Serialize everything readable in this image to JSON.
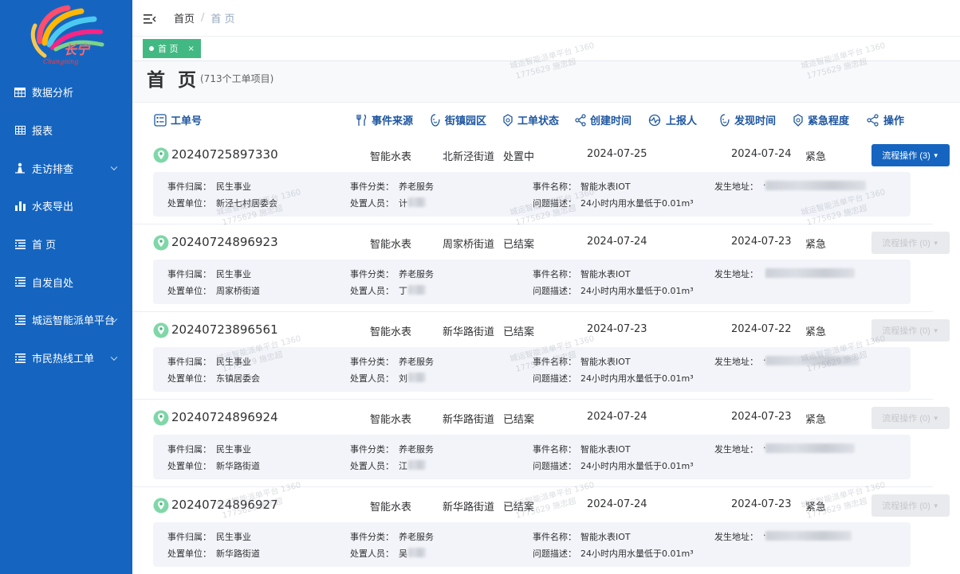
{
  "sidebar": {
    "items": [
      {
        "label": "数据分析",
        "icon": "table-icon",
        "expandable": false
      },
      {
        "label": "报表",
        "icon": "grid-icon",
        "expandable": false
      },
      {
        "label": "走访排查",
        "icon": "person-icon",
        "expandable": true
      },
      {
        "label": "水表导出",
        "icon": "bar-chart-icon",
        "expandable": false
      },
      {
        "label": "首 页",
        "icon": "list-icon",
        "expandable": false
      },
      {
        "label": "自发自处",
        "icon": "list-icon",
        "expandable": false
      },
      {
        "label": "城运智能派单平台",
        "icon": "list-icon",
        "expandable": true
      },
      {
        "label": "市民热线工单",
        "icon": "list-icon",
        "expandable": true
      }
    ]
  },
  "header": {
    "breadcrumb_root": "首页",
    "breadcrumb_sep": "/",
    "breadcrumb_current": "首 页"
  },
  "tags": {
    "active_label": "首 页",
    "close": "×"
  },
  "page": {
    "title": "首 页",
    "count": "(713个工单项目)"
  },
  "columns": {
    "work_order": "工单号",
    "source": "事件来源",
    "street": "街镇园区",
    "status": "工单状态",
    "created": "创建时间",
    "reporter": "上报人",
    "found": "发现时间",
    "urgency": "紧急程度",
    "action": "操作"
  },
  "detail_labels": {
    "belong": "事件归属：",
    "unit": "处置单位：",
    "category": "事件分类：",
    "person": "处置人员：",
    "name": "事件名称：",
    "desc": "问题描述：",
    "address": "发生地址："
  },
  "rows": [
    {
      "id": "20240725897330",
      "source": "智能水表",
      "street": "北新泾街道",
      "status": "处置中",
      "created": "2024-07-25",
      "found": "2024-07-24",
      "urgency": "紧急",
      "action": "流程操作 (3)",
      "action_enabled": true,
      "belong": "民生事业",
      "unit": "新泾七村居委会",
      "category": "养老服务",
      "person": "计",
      "name": "智能水表IOT",
      "desc": "24小时内用水量低于0.01m³",
      "address": "·"
    },
    {
      "id": "20240724896923",
      "source": "智能水表",
      "street": "周家桥街道",
      "status": "已结案",
      "created": "2024-07-24",
      "found": "2024-07-23",
      "urgency": "紧急",
      "action": "流程操作 (0)",
      "action_enabled": false,
      "belong": "民生事业",
      "unit": "周家桥街道",
      "category": "养老服务",
      "person": "丁",
      "name": "智能水表IOT",
      "desc": "24小时内用水量低于0.01m³",
      "address": ""
    },
    {
      "id": "20240723896561",
      "source": "智能水表",
      "street": "新华路街道",
      "status": "已结案",
      "created": "2024-07-23",
      "found": "2024-07-22",
      "urgency": "紧急",
      "action": "流程操作 (0)",
      "action_enabled": false,
      "belong": "民生事业",
      "unit": "东镇居委会",
      "category": "养老服务",
      "person": "刘",
      "name": "智能水表IOT",
      "desc": "24小时内用水量低于0.01m³",
      "address": "·"
    },
    {
      "id": "20240724896924",
      "source": "智能水表",
      "street": "新华路街道",
      "status": "已结案",
      "created": "2024-07-24",
      "found": "2024-07-23",
      "urgency": "紧急",
      "action": "流程操作 (0)",
      "action_enabled": false,
      "belong": "民生事业",
      "unit": "新华路街道",
      "category": "养老服务",
      "person": "江",
      "name": "智能水表IOT",
      "desc": "24小时内用水量低于0.01m³",
      "address": "·"
    },
    {
      "id": "20240724896927",
      "source": "智能水表",
      "street": "新华路街道",
      "status": "已结案",
      "created": "2024-07-24",
      "found": "2024-07-23",
      "urgency": "紧急",
      "action": "流程操作 (0)",
      "action_enabled": false,
      "belong": "民生事业",
      "unit": "新华路街道",
      "category": "养老服务",
      "person": "吴",
      "name": "智能水表IOT",
      "desc": "24小时内用水量低于0.01m³",
      "address": "·"
    }
  ],
  "watermark": {
    "line1": "城运智能派单平台 1360",
    "line2": "1775629 施忠超"
  },
  "colors": {
    "sidebar": "#1565c0",
    "tag": "#42b983",
    "header_text": "#1e56a0",
    "button_active": "#1565c0",
    "button_disabled": "#e9eaed"
  }
}
